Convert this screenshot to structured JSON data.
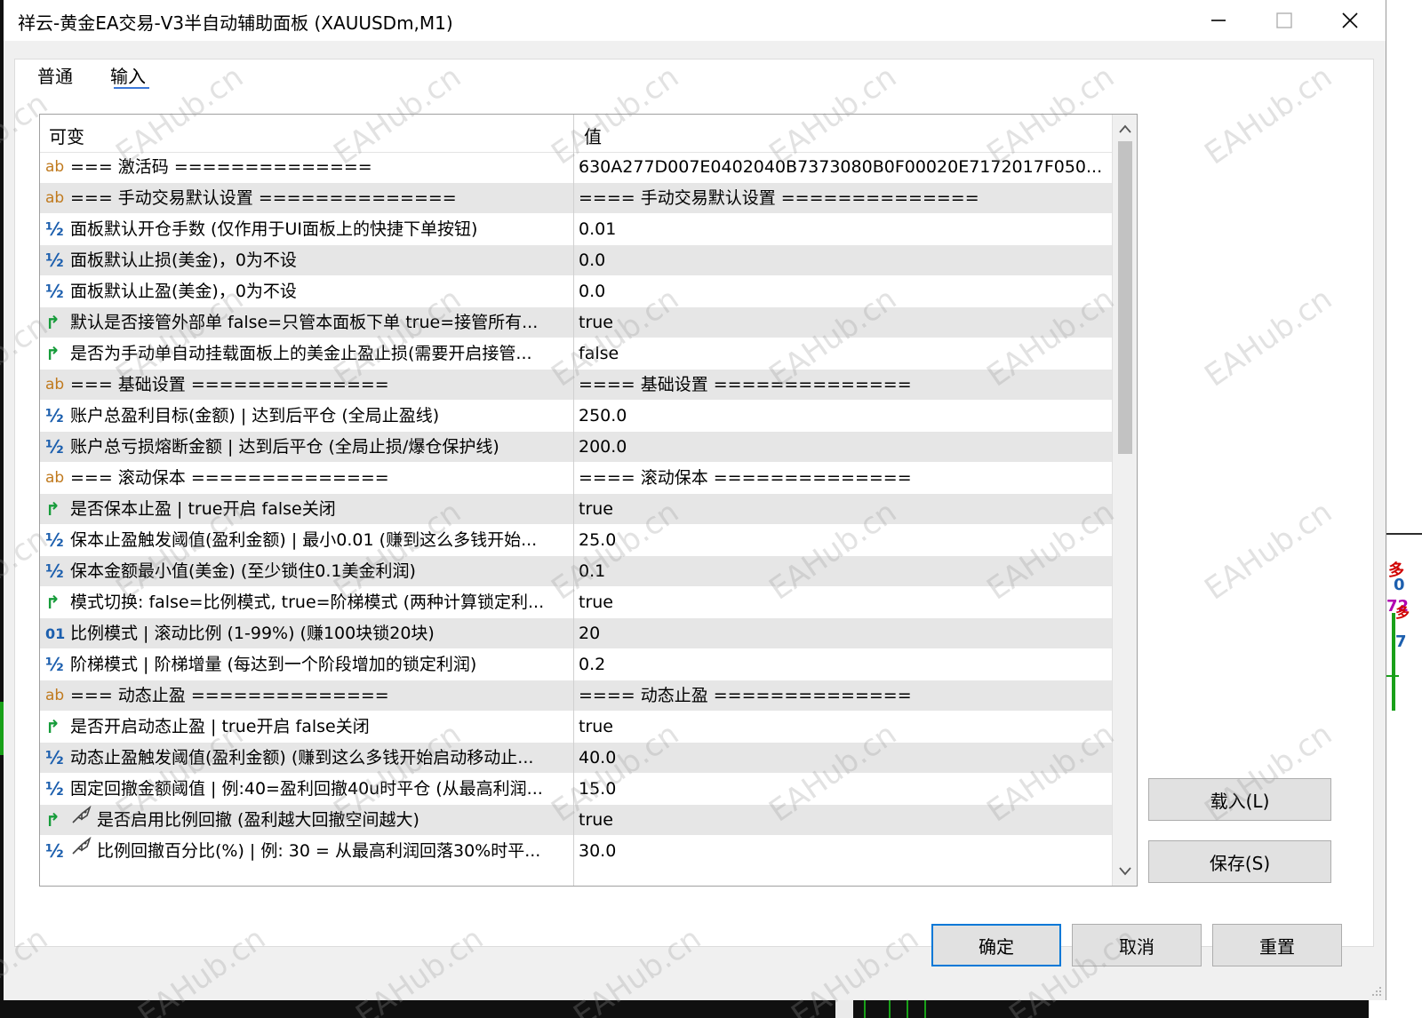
{
  "window": {
    "title": "祥云-黄金EA交易-V3半自动辅助面板 (XAUUSDm,M1)",
    "minimize_icon": "minimize-icon",
    "maximize_icon": "maximize-icon",
    "close_icon": "close-icon"
  },
  "tabs": [
    {
      "label": "普通",
      "active": false
    },
    {
      "label": "输入",
      "active": true
    }
  ],
  "grid": {
    "col_variable": "可变",
    "col_value": "值",
    "rows": [
      {
        "type": "ab",
        "icon_text": "ab",
        "name": "=== 激活码 ==============",
        "value": "630A277D007E0402040B7373080B0F00020E7172017F050..."
      },
      {
        "type": "ab",
        "icon_text": "ab",
        "name": "=== 手动交易默认设置 ==============",
        "value": "==== 手动交易默认设置 =============="
      },
      {
        "type": "double",
        "icon_text": "½",
        "name": "面板默认开仓手数 (仅作用于UI面板上的快捷下单按钮)",
        "value": "0.01"
      },
      {
        "type": "double",
        "icon_text": "½",
        "name": "面板默认止损(美金)，0为不设",
        "value": "0.0"
      },
      {
        "type": "double",
        "icon_text": "½",
        "name": "面板默认止盈(美金)，0为不设",
        "value": "0.0"
      },
      {
        "type": "bool",
        "icon_text": "↱",
        "name": "默认是否接管外部单 false=只管本面板下单 true=接管所有...",
        "value": "true"
      },
      {
        "type": "bool",
        "icon_text": "↱",
        "name": "是否为手动单自动挂载面板上的美金止盈止损(需要开启接管...",
        "value": "false"
      },
      {
        "type": "ab",
        "icon_text": "ab",
        "name": "=== 基础设置 ==============",
        "value": "==== 基础设置 =============="
      },
      {
        "type": "double",
        "icon_text": "½",
        "name": "账户总盈利目标(金额) | 达到后平仓 (全局止盈线)",
        "value": "250.0"
      },
      {
        "type": "double",
        "icon_text": "½",
        "name": "账户总亏损熔断金额 | 达到后平仓 (全局止损/爆仓保护线)",
        "value": "200.0"
      },
      {
        "type": "ab",
        "icon_text": "ab",
        "name": "=== 滚动保本 ==============",
        "value": "==== 滚动保本 =============="
      },
      {
        "type": "bool",
        "icon_text": "↱",
        "name": "是否保本止盈 | true开启 false关闭",
        "value": "true"
      },
      {
        "type": "double",
        "icon_text": "½",
        "name": "保本止盈触发阈值(盈利金额) | 最小0.01 (赚到这么多钱开始...",
        "value": "25.0"
      },
      {
        "type": "double",
        "icon_text": "½",
        "name": "保本金额最小值(美金) (至少锁住0.1美金利润)",
        "value": "0.1"
      },
      {
        "type": "bool",
        "icon_text": "↱",
        "name": "模式切换: false=比例模式, true=阶梯模式 (两种计算锁定利...",
        "value": "true"
      },
      {
        "type": "int",
        "icon_text": "01",
        "name": "比例模式 | 滚动比例 (1-99%) (赚100块锁20块)",
        "value": "20"
      },
      {
        "type": "double",
        "icon_text": "½",
        "name": "阶梯模式 | 阶梯增量 (每达到一个阶段增加的锁定利润)",
        "value": "0.2"
      },
      {
        "type": "ab",
        "icon_text": "ab",
        "name": "=== 动态止盈 ==============",
        "value": "==== 动态止盈 =============="
      },
      {
        "type": "bool",
        "icon_text": "↱",
        "name": "是否开启动态止盈 | true开启 false关闭",
        "value": "true"
      },
      {
        "type": "double",
        "icon_text": "½",
        "name": "动态止盈触发阈值(盈利金额) (赚到这么多钱开始启动移动止...",
        "value": "40.0"
      },
      {
        "type": "double",
        "icon_text": "½",
        "name": "固定回撤金额阈值 | 例:40=盈利回撤40u时平仓 (从最高利润...",
        "value": "15.0"
      },
      {
        "type": "bool",
        "icon_text": "↱",
        "name": "是否启用比例回撤 (盈利越大回撤空间越大)",
        "value": "true",
        "rocket": true
      },
      {
        "type": "double",
        "icon_text": "½",
        "name": "比例回撤百分比(%) | 例: 30 = 从最高利润回落30%时平...",
        "value": "30.0",
        "rocket": true
      }
    ]
  },
  "buttons": {
    "load": "载入(L)",
    "save": "保存(S)",
    "ok": "确定",
    "cancel": "取消",
    "reset": "重置"
  },
  "watermark": "EAHub.cn",
  "chart_fragments": [
    "多",
    "0",
    "72",
    "多",
    "7"
  ],
  "colors": {
    "accent": "#0078d7",
    "row_alt": "#e6e6e6",
    "icon_ab": "#c07a1e",
    "icon_num": "#1c5fae",
    "icon_bool": "#169c3a"
  }
}
